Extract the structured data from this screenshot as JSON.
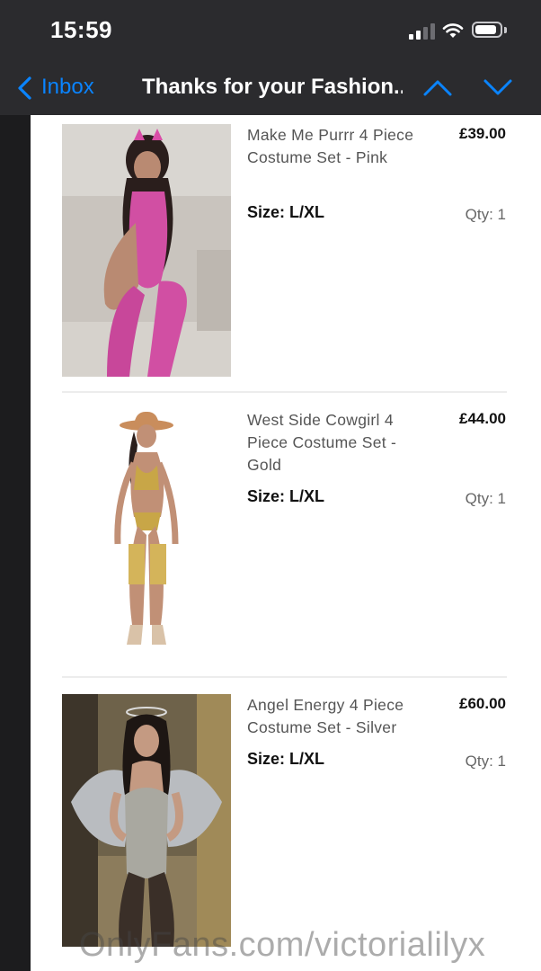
{
  "status_bar": {
    "time": "15:59"
  },
  "nav": {
    "back_label": "Inbox",
    "title": "Thanks for your Fashion..."
  },
  "items": [
    {
      "name": "Make Me Purrr 4 Piece Costume Set - Pink",
      "price": "£39.00",
      "size": "Size: L/XL",
      "qty": "Qty: 1"
    },
    {
      "name": "West Side Cowgirl 4 Piece Costume Set - Gold",
      "price": "£44.00",
      "size": "Size: L/XL",
      "qty": "Qty: 1"
    },
    {
      "name": "Angel Energy 4 Piece Costume Set - Silver",
      "price": "£60.00",
      "size": "Size: L/XL",
      "qty": "Qty: 1"
    }
  ],
  "watermark": "OnlyFans.com/victorialilyx",
  "colors": {
    "accent": "#0a84ff",
    "nav_bg": "#2b2b2e",
    "mail_bg": "#ffffff"
  }
}
